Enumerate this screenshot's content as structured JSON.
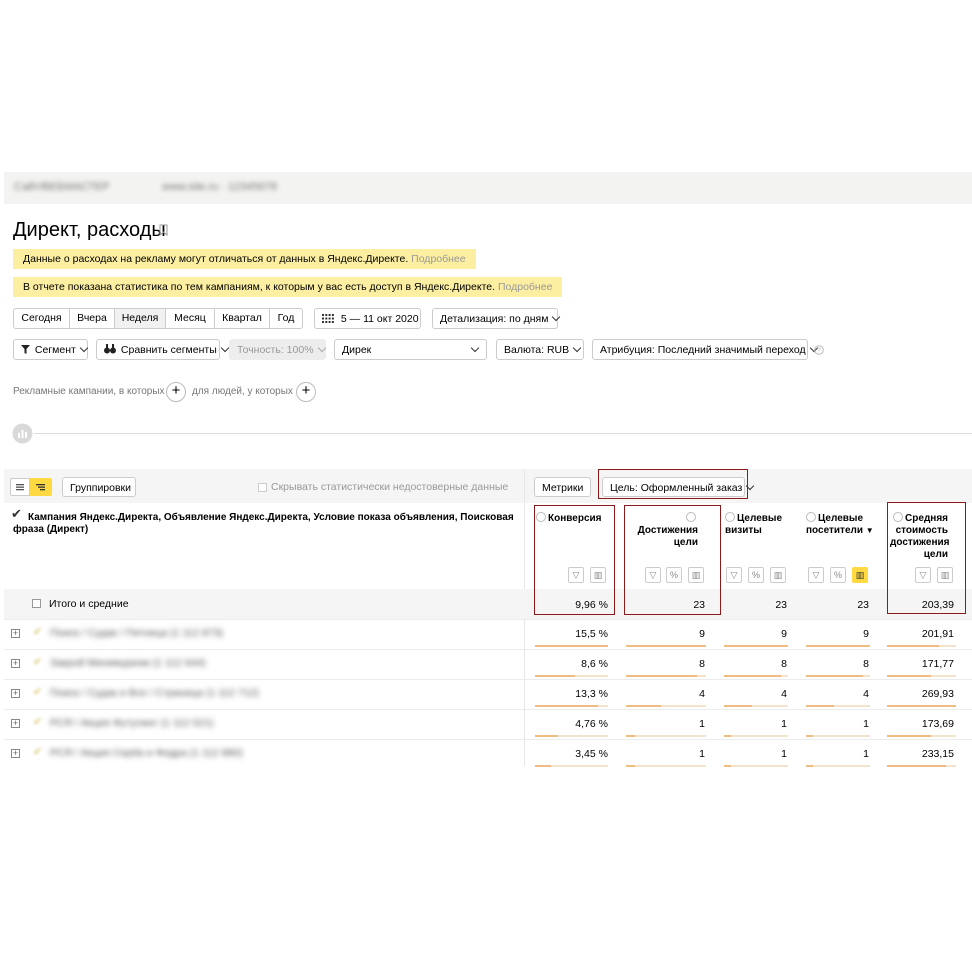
{
  "topbar": {
    "counter": "Сайт/ВЕБМАСТЕР",
    "extra": "www.site.ru · 12345678"
  },
  "report": {
    "title": "Директ, расходы"
  },
  "notices": [
    {
      "text": "Данные о расходах на рекламу могут отличаться от данных в Яндекс.Директе.",
      "link": "Подробнее"
    },
    {
      "text": "В отчете показана статистика по тем кампаниям, к которым у вас есть доступ в Яндекс.Директе.",
      "link": "Подробнее"
    }
  ],
  "period": {
    "options": [
      "Сегодня",
      "Вчера",
      "Неделя",
      "Месяц",
      "Квартал",
      "Год"
    ],
    "selected": "Неделя",
    "date_range": "5 — 11 окт 2020",
    "detail": "Детализация: по дням"
  },
  "filters": {
    "segment": "Сегмент",
    "compare": "Сравнить сегменты",
    "accuracy": "Точность: 100%",
    "source": "Дирек",
    "currency": "Валюта: RUB",
    "attribution": "Атрибуция: Последний значимый переход"
  },
  "segment_builder": {
    "campaigns_text": "Рекламные кампании, в которых",
    "people_text": "для людей, у которых"
  },
  "table_toolbar": {
    "groupings": "Группировки",
    "hide_unreliable": "Скрывать статистически недостоверные данные",
    "metrics": "Метрики",
    "goal": "Цель: Оформленный заказ"
  },
  "table": {
    "dimension_header": "Кампания Яндекс.Директа, Объявление Яндекс.Директа, Условие показа объявления, Поисковая фраза (Директ)",
    "columns": [
      "Конверсия",
      "Достижения цели",
      "Целевые визиты",
      "Целевые посетители",
      "Средняя стоимость достижения цели"
    ],
    "sort_indicator": "▼",
    "totals_label": "Итого и средние",
    "totals": [
      "9,96 %",
      "23",
      "23",
      "23",
      "203,39"
    ],
    "rows": [
      {
        "name": "Поиск / Судак / Пятница  (1 112 873)",
        "values": [
          "15,5 %",
          "9",
          "9",
          "9",
          "201,91"
        ],
        "shares": [
          1.0,
          1.0,
          1.0,
          1.0,
          0.75
        ]
      },
      {
        "name": "Закрой Минимуризм  (1 112 644)",
        "values": [
          "8,6 %",
          "8",
          "8",
          "8",
          "171,77"
        ],
        "shares": [
          0.55,
          0.89,
          0.89,
          0.89,
          0.64
        ]
      },
      {
        "name": "Поиск / Судак и Все / Страница  (1 112 712)",
        "values": [
          "13,3 %",
          "4",
          "4",
          "4",
          "269,93"
        ],
        "shares": [
          0.86,
          0.44,
          0.44,
          0.44,
          1.0
        ]
      },
      {
        "name": "РСЯ / Акция Футулинг  (1 112 521)",
        "values": [
          "4,76 %",
          "1",
          "1",
          "1",
          "173,69"
        ],
        "shares": [
          0.31,
          0.11,
          0.11,
          0.11,
          0.64
        ]
      },
      {
        "name": "РСЯ / Акция Серба и Федра  (1 112 880)",
        "values": [
          "3,45 %",
          "1",
          "1",
          "1",
          "233,15"
        ],
        "shares": [
          0.22,
          0.11,
          0.11,
          0.11,
          0.86
        ]
      }
    ]
  },
  "colors": {
    "notice_bg": "#fcefa1",
    "link": "#999999",
    "highlight_border": "#8b1a1a",
    "bar": "#efbd82",
    "active_tool": "#ffd942"
  }
}
